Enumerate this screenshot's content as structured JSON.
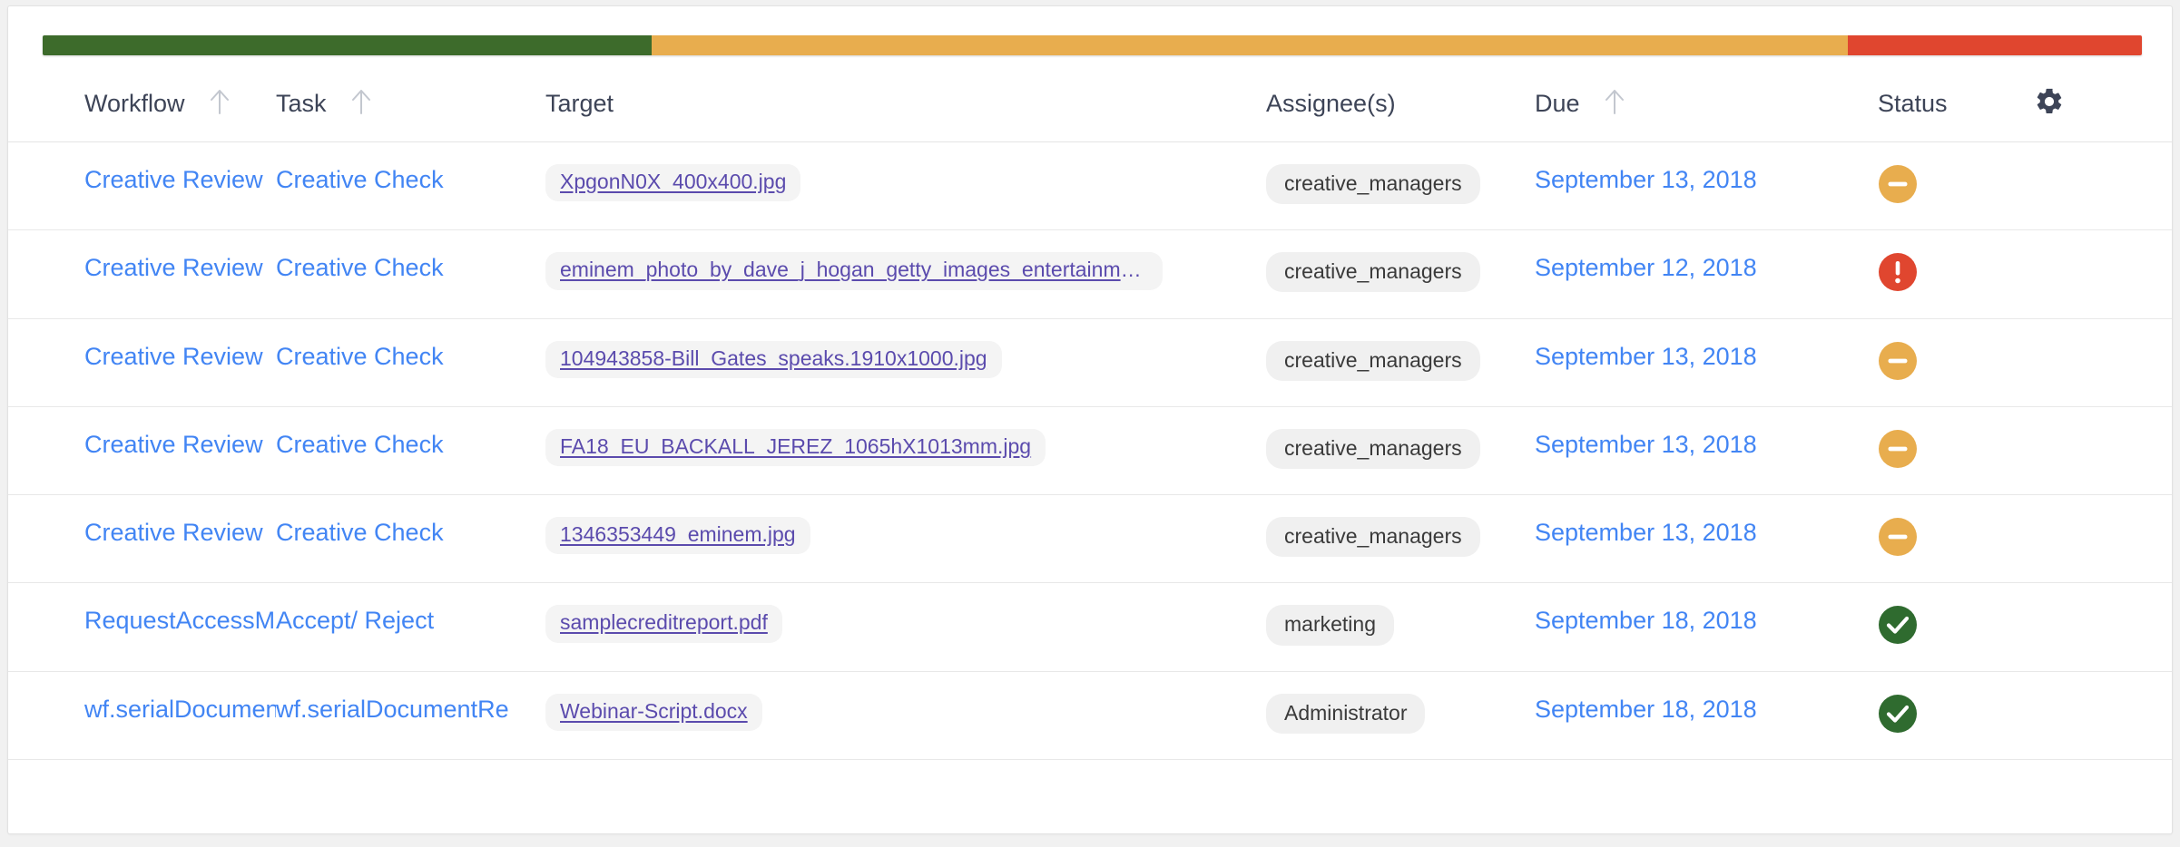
{
  "progress": {
    "segments": [
      {
        "name": "complete",
        "color": "#3d6b2b",
        "percent": 29
      },
      {
        "name": "in-progress",
        "color": "#e8ad4e",
        "percent": 57
      },
      {
        "name": "overdue",
        "color": "#e0462f",
        "percent": 14
      }
    ]
  },
  "table": {
    "columns": [
      {
        "key": "workflow",
        "label": "Workflow",
        "sortable": true
      },
      {
        "key": "task",
        "label": "Task",
        "sortable": true
      },
      {
        "key": "target",
        "label": "Target",
        "sortable": false
      },
      {
        "key": "assignee",
        "label": "Assignee(s)",
        "sortable": false
      },
      {
        "key": "due",
        "label": "Due",
        "sortable": true
      },
      {
        "key": "status",
        "label": "Status",
        "sortable": false
      }
    ],
    "settings_icon": "gear-icon",
    "rows": [
      {
        "workflow": "Creative Review",
        "task": "Creative Check",
        "target": "XpgonN0X_400x400.jpg",
        "assignee": "creative_managers",
        "due": "September 13, 2018",
        "status": "pending",
        "status_icon": "minus-circle-icon",
        "status_color": "#e8ad4e"
      },
      {
        "workflow": "Creative Review",
        "task": "Creative Check",
        "target": "eminem_photo_by_dave_j_hogan_getty_images_entertainme…",
        "assignee": "creative_managers",
        "due": "September 12, 2018",
        "status": "overdue",
        "status_icon": "exclamation-circle-icon",
        "status_color": "#e0462f"
      },
      {
        "workflow": "Creative Review",
        "task": "Creative Check",
        "target": "104943858-Bill_Gates_speaks.1910x1000.jpg",
        "assignee": "creative_managers",
        "due": "September 13, 2018",
        "status": "pending",
        "status_icon": "minus-circle-icon",
        "status_color": "#e8ad4e"
      },
      {
        "workflow": "Creative Review",
        "task": "Creative Check",
        "target": "FA18_EU_BACKALL_JEREZ_1065hX1013mm.jpg",
        "assignee": "creative_managers",
        "due": "September 13, 2018",
        "status": "pending",
        "status_icon": "minus-circle-icon",
        "status_color": "#e8ad4e"
      },
      {
        "workflow": "Creative Review",
        "task": "Creative Check",
        "target": "1346353449_eminem.jpg",
        "assignee": "creative_managers",
        "due": "September 13, 2018",
        "status": "pending",
        "status_icon": "minus-circle-icon",
        "status_color": "#e8ad4e"
      },
      {
        "workflow": "RequestAccessMaste",
        "task": "Accept/ Reject",
        "target": "samplecreditreport.pdf",
        "assignee": "marketing",
        "due": "September 18, 2018",
        "status": "complete",
        "status_icon": "check-circle-icon",
        "status_color": "#2f6b2f"
      },
      {
        "workflow": "wf.serialDocumentRe",
        "task": "wf.serialDocumentRe",
        "target": "Webinar-Script.docx",
        "assignee": "Administrator",
        "due": "September 18, 2018",
        "status": "complete",
        "status_icon": "check-circle-icon",
        "status_color": "#2f6b2f"
      }
    ]
  }
}
